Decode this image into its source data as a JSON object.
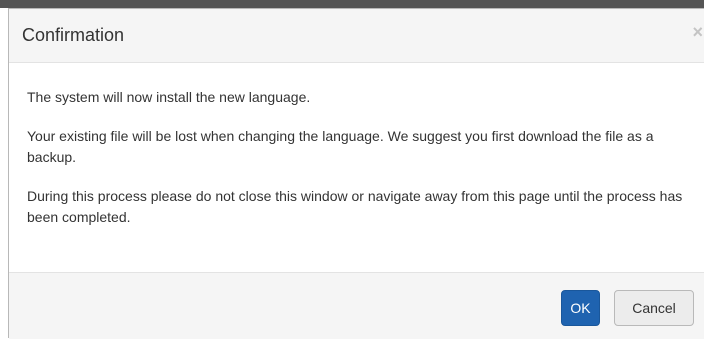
{
  "dialog": {
    "title": "Confirmation",
    "close_glyph": "×",
    "close_icon": "close-icon",
    "body": {
      "paragraphs": [
        "The system will now install the new language.",
        "Your existing file will be lost when changing the language. We suggest you first download the file as a backup.",
        "During this process please do not close this window or navigate away from this page until the process has been completed."
      ]
    },
    "footer": {
      "ok_label": "OK",
      "cancel_label": "Cancel"
    }
  },
  "colors": {
    "primary": "#1f63b0",
    "header_bg": "#f5f5f5",
    "text": "#333333"
  }
}
